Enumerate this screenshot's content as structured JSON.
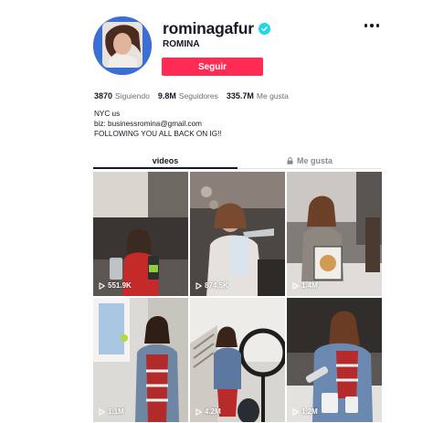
{
  "profile": {
    "username": "rominagafur",
    "display_name": "ROMINA",
    "verified": true,
    "follow_label": "Seguir",
    "accent_color": "#fe2c55",
    "verified_color": "#20d5ec"
  },
  "stats": [
    {
      "value": "3870",
      "label": "Siguiendo"
    },
    {
      "value": "9.8M",
      "label": "Seguidores"
    },
    {
      "value": "335.7M",
      "label": "Me gusta"
    }
  ],
  "bio": [
    "NYC us",
    "biz: businessromina@gmail.com",
    "FOLLOWING YOU ALL BACK ON IG!!"
  ],
  "tabs": [
    {
      "label": "videos",
      "active": true,
      "icon": null
    },
    {
      "label": "Me gusta",
      "active": false,
      "icon": "lock-icon"
    }
  ],
  "videos": [
    {
      "views": "551.9K"
    },
    {
      "views": "874.5K"
    },
    {
      "views": "1.4M"
    },
    {
      "views": "1.1M"
    },
    {
      "views": "4.2M"
    },
    {
      "views": "1.2M"
    }
  ],
  "icons": {
    "more": "more-options-icon",
    "play": "play-icon",
    "verified": "verified-badge-icon",
    "lock": "lock-icon"
  }
}
